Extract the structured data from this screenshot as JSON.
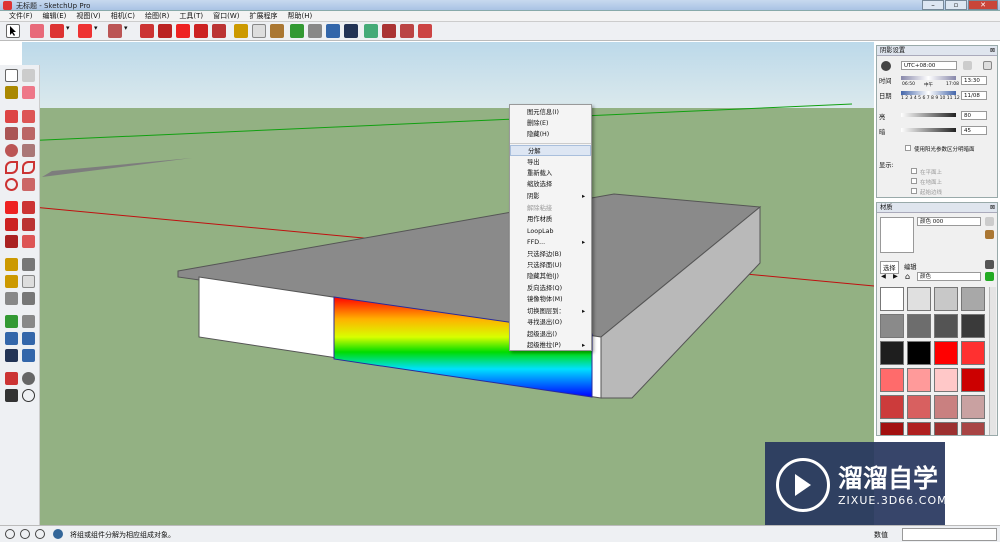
{
  "window": {
    "title": "无标题 - SketchUp Pro"
  },
  "menu": [
    "文件(F)",
    "编辑(E)",
    "视图(V)",
    "相机(C)",
    "绘图(R)",
    "工具(T)",
    "窗口(W)",
    "扩展程序",
    "帮助(H)"
  ],
  "context_menu": {
    "items": [
      {
        "label": "图元信息(I)",
        "state": "normal"
      },
      {
        "label": "删除(E)",
        "state": "normal"
      },
      {
        "label": "隐藏(H)",
        "state": "normal"
      },
      {
        "label": "分解",
        "state": "highlighted"
      },
      {
        "label": "导出",
        "state": "normal"
      },
      {
        "label": "重新载入",
        "state": "normal"
      },
      {
        "label": "缩放选择",
        "state": "normal"
      },
      {
        "label": "阴影",
        "state": "normal",
        "submenu": true
      },
      {
        "label": "解除粘接",
        "state": "disabled"
      },
      {
        "label": "用作材质",
        "state": "normal"
      },
      {
        "label": "LoopLab",
        "state": "normal"
      },
      {
        "label": "FFD...",
        "state": "normal",
        "submenu": true
      },
      {
        "label": "只选择边(B)",
        "state": "normal"
      },
      {
        "label": "只选择面(U)",
        "state": "normal"
      },
      {
        "label": "隐藏其他(J)",
        "state": "normal"
      },
      {
        "label": "反向选择(Q)",
        "state": "normal"
      },
      {
        "label": "镜像物体(M)",
        "state": "normal"
      },
      {
        "label": "切换图层到：",
        "state": "normal",
        "submenu": true
      },
      {
        "label": "寻找退出(O)",
        "state": "normal"
      },
      {
        "label": "超级退出()",
        "state": "normal"
      },
      {
        "label": "超级推拉(P)",
        "state": "normal",
        "submenu": true
      }
    ]
  },
  "shadow_panel": {
    "title": "阴影设置",
    "close": "⊠",
    "timezone": "UTC+08:00",
    "time_label": "时间",
    "time_start": "06:50",
    "time_mid": "中午",
    "time_end": "17:08",
    "time_value": "13:30",
    "date_label": "日期",
    "months": "1 2 3 4 5 6 7 8 9 10 11 12",
    "date_value": "11/08",
    "light_label": "亮",
    "light_value": "80",
    "dark_label": "暗",
    "dark_value": "45",
    "sun_shading": "使用阳光参数区分明暗面",
    "display_label": "显示:",
    "on_faces": "在平面上",
    "on_ground": "在地面上",
    "from_edges": "起始边线"
  },
  "materials_panel": {
    "title": "材质",
    "close": "⊠",
    "material_name": "颜色 000",
    "tab_select": "选择",
    "tab_edit": "编辑",
    "collection": "颜色",
    "swatches": [
      "#ffffff",
      "#e0e0e0",
      "#c8c8c8",
      "#a8a8a8",
      "#8a8a8a",
      "#6d6d6d",
      "#545454",
      "#3a3a3a",
      "#1e1e1e",
      "#000000",
      "#ff0000",
      "#ff3030",
      "#ff6b6b",
      "#ff9a9a",
      "#ffc8c8",
      "#cc0000",
      "#cc3b3b",
      "#d86060",
      "#c98080",
      "#c9a1a1",
      "#a31010",
      "#b02020",
      "#9c3030",
      "#a84444"
    ]
  },
  "status": {
    "message": "将组或组件分解为相应组成对象。",
    "measurements_label": "数值",
    "measurements_value": ""
  },
  "watermark": {
    "title": "溜溜自学",
    "url": "ZIXUE.3D66.COM"
  },
  "colors": {
    "ground": "#93b183",
    "sky": "#bcd9ea",
    "box_top": "#8c8c8c",
    "box_side": "#ffffff",
    "box_right": "#b9b9b9"
  }
}
